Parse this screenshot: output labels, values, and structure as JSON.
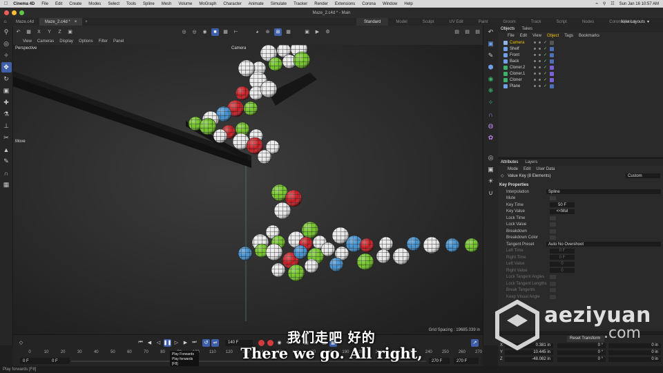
{
  "menubar": {
    "app": "Cinema 4D",
    "items": [
      "File",
      "Edit",
      "Create",
      "Modes",
      "Select",
      "Tools",
      "Spline",
      "Mesh",
      "Volume",
      "MoGraph",
      "Character",
      "Animate",
      "Simulate",
      "Tracker",
      "Render",
      "Extensions",
      "Corona",
      "Window",
      "Help"
    ],
    "clock": "Sun Jan 16  10:57 AM"
  },
  "window": {
    "title": "Maze_2.c4d * - Main"
  },
  "doc_tabs": [
    {
      "label": "Maze.c4d"
    },
    {
      "label": "Maze_2.c4d *"
    }
  ],
  "layouts": {
    "items": [
      "Standard",
      "Model",
      "Sculpt",
      "UV Edit",
      "Paint",
      "Groom",
      "Track",
      "Script",
      "Nodes",
      "Corona (User)"
    ],
    "active": "Standard",
    "new_layouts": "New Layouts"
  },
  "viewport": {
    "menu": [
      "View",
      "Cameras",
      "Display",
      "Options",
      "Filter",
      "Panel"
    ],
    "label": "Perspective",
    "camera_label": "Camera",
    "move_label": "Move",
    "grid_spacing": "Grid Spacing : 19685.039 in"
  },
  "timeline": {
    "current_frame": "140 F",
    "start_field": "0 F",
    "start_field2": "0 F",
    "end_field": "270 F",
    "end_field2": "270 F",
    "ruler": [
      "0",
      "10",
      "20",
      "30",
      "40",
      "50",
      "60",
      "70",
      "80",
      "90",
      "100",
      "110",
      "120",
      "130",
      "140",
      "150",
      "160",
      "170",
      "180",
      "190",
      "200",
      "210",
      "220",
      "230",
      "240",
      "250",
      "260",
      "270"
    ],
    "tooltip": {
      "title": "Play Forwards",
      "line2": "Play forwards",
      "shortcut": "[F8]"
    }
  },
  "status": "Play forwards [F8]",
  "objects_panel": {
    "tabs": [
      "Objects",
      "Takes"
    ],
    "menu": [
      "File",
      "Edit",
      "View",
      "Object",
      "Tags",
      "Bookmarks"
    ],
    "active_menu": "Object",
    "rows": [
      {
        "name": "Camera",
        "color": "#f2c500",
        "icon_color": "#8fb3e8"
      },
      {
        "name": "Shelf",
        "color": "#d4d4d4",
        "icon_color": "#6fa0e8"
      },
      {
        "name": "Front",
        "color": "#d4d4d4",
        "icon_color": "#6fa0e8"
      },
      {
        "name": "Back",
        "color": "#d4d4d4",
        "icon_color": "#6fa0e8"
      },
      {
        "name": "Cloner.2",
        "color": "#d4d4d4",
        "icon_color": "#3bb36a"
      },
      {
        "name": "Cloner.1",
        "color": "#d4d4d4",
        "icon_color": "#3bb36a"
      },
      {
        "name": "Cloner",
        "color": "#d4d4d4",
        "icon_color": "#3bb36a"
      },
      {
        "name": "Plane",
        "color": "#d4d4d4",
        "icon_color": "#6fa0e8"
      }
    ]
  },
  "attributes_panel": {
    "tabs": [
      "Attributes",
      "Layers"
    ],
    "menu": [
      "Mode",
      "Edit",
      "User Data"
    ],
    "title": "Value Key (8 Elements)",
    "preset": "Custom",
    "section": "Key Properties",
    "interp_label": "Interpolation",
    "interp_value": "Spline",
    "rows": [
      {
        "label": "Mute",
        "kind": "check",
        "dim": false
      },
      {
        "label": "Key Time",
        "kind": "value",
        "value": "50 F",
        "dim": false
      },
      {
        "label": "Key Value",
        "kind": "value",
        "value": "<<Mul",
        "dim": false
      },
      {
        "label": "Lock Time",
        "kind": "check",
        "dim": false
      },
      {
        "label": "Lock Value",
        "kind": "check",
        "dim": false
      },
      {
        "label": "Breakdown",
        "kind": "check",
        "dim": false
      },
      {
        "label": "Breakdown Color",
        "kind": "check",
        "dim": false
      },
      {
        "label": "Tangent Preset",
        "kind": "drop",
        "value": "Auto No Overshoot",
        "dim": false
      },
      {
        "label": "Left Time",
        "kind": "value",
        "value": "0 F",
        "dim": true
      },
      {
        "label": "Right Time",
        "kind": "value",
        "value": "0 F",
        "dim": true
      },
      {
        "label": "Left Value",
        "kind": "value",
        "value": "0",
        "dim": true
      },
      {
        "label": "Right Value",
        "kind": "value",
        "value": "0",
        "dim": true
      },
      {
        "label": "Lock Tangent Angles",
        "kind": "check",
        "dim": true
      },
      {
        "label": "Lock Tangent Lengths",
        "kind": "check",
        "dim": true
      },
      {
        "label": "Break Tangents",
        "kind": "check",
        "dim": true
      },
      {
        "label": "Keep Visual Angle",
        "kind": "check",
        "dim": true
      }
    ]
  },
  "coordinates": {
    "reset": "Reset Transform",
    "rows": [
      {
        "axis": "X",
        "pos": "0.381 in",
        "rot": "0 °",
        "scale": "0 in"
      },
      {
        "axis": "Y",
        "pos": "10.445 in",
        "rot": "0 °",
        "scale": "0 in"
      },
      {
        "axis": "Z",
        "pos": "-48.082 in",
        "rot": "0 °",
        "scale": "0 in"
      }
    ]
  },
  "watermark": {
    "brand": "aeziyuan",
    "tld": ".com"
  },
  "subtitles": {
    "cn": "我们走吧 好的",
    "en": "There we go. All right,"
  },
  "colors": {
    "accent": "#3f5fa8",
    "highlight": "#f2c500",
    "ball_red": "#c8161d",
    "ball_green": "#6fc422",
    "ball_blue": "#3f8fd0",
    "ball_white": "#e8e8e8"
  }
}
